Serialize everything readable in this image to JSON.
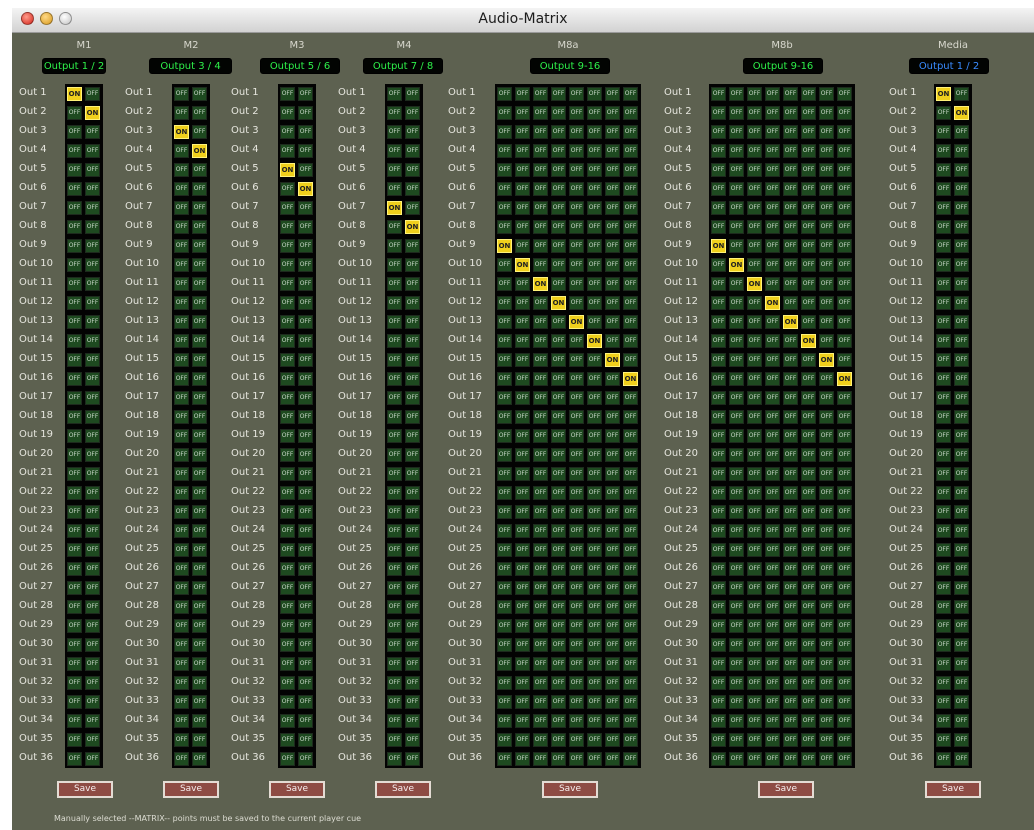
{
  "window": {
    "title": "Audio-Matrix"
  },
  "row_labels": [
    "Out 1",
    "Out 2",
    "Out 3",
    "Out 4",
    "Out 5",
    "Out 6",
    "Out 7",
    "Out 8",
    "Out 9",
    "Out 10",
    "Out 11",
    "Out 12",
    "Out 13",
    "Out 14",
    "Out 15",
    "Out 16",
    "Out 17",
    "Out 18",
    "Out 19",
    "Out 20",
    "Out 21",
    "Out 22",
    "Out 23",
    "Out 24",
    "Out 25",
    "Out 26",
    "Out 27",
    "Out 28",
    "Out 29",
    "Out 30",
    "Out 31",
    "Out 32",
    "Out 33",
    "Out 34",
    "Out 35",
    "Out 36"
  ],
  "cell_on_label": "ON",
  "cell_off_label": "OFF",
  "save_label": "Save",
  "matrices": [
    {
      "id": "m1",
      "title": "M1",
      "output_selector": "Output 1 / 2",
      "columns": 2,
      "on_points": [
        [
          1,
          1
        ],
        [
          2,
          2
        ]
      ]
    },
    {
      "id": "m2",
      "title": "M2",
      "output_selector": "Output 3 / 4",
      "columns": 2,
      "on_points": [
        [
          3,
          1
        ],
        [
          4,
          2
        ]
      ]
    },
    {
      "id": "m3",
      "title": "M3",
      "output_selector": "Output 5 / 6",
      "columns": 2,
      "on_points": [
        [
          5,
          1
        ],
        [
          6,
          2
        ]
      ]
    },
    {
      "id": "m4",
      "title": "M4",
      "output_selector": "Output 7 / 8",
      "columns": 2,
      "on_points": [
        [
          7,
          1
        ],
        [
          8,
          2
        ]
      ]
    },
    {
      "id": "m8a",
      "title": "M8a",
      "output_selector": "Output 9-16",
      "columns": 8,
      "on_points": [
        [
          9,
          1
        ],
        [
          10,
          2
        ],
        [
          11,
          3
        ],
        [
          12,
          4
        ],
        [
          13,
          5
        ],
        [
          14,
          6
        ],
        [
          15,
          7
        ],
        [
          16,
          8
        ]
      ]
    },
    {
      "id": "m8b",
      "title": "M8b",
      "output_selector": "Output 9-16",
      "columns": 8,
      "on_points": [
        [
          9,
          1
        ],
        [
          10,
          2
        ],
        [
          11,
          3
        ],
        [
          12,
          4
        ],
        [
          13,
          5
        ],
        [
          14,
          6
        ],
        [
          15,
          7
        ],
        [
          16,
          8
        ]
      ]
    },
    {
      "id": "media",
      "title": "Media",
      "output_selector": "Output 1 / 2",
      "selector_color": "#3a8cff",
      "columns": 2,
      "on_points": [
        [
          1,
          1
        ],
        [
          2,
          2
        ]
      ]
    }
  ],
  "footer_note": "Manually selected --MATRIX-- points must be saved to the current player cue",
  "colors": {
    "window_bg": "#5d6150",
    "cell_off": "#1e4a20",
    "cell_on": "#f0d01c",
    "selector_text": "#2ef04a",
    "save_button": "#8e4c44"
  }
}
